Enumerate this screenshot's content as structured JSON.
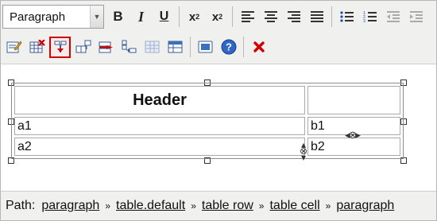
{
  "toolbar": {
    "format_select": {
      "value": "Paragraph"
    },
    "row1": [
      {
        "name": "bold-button",
        "text": "B"
      },
      {
        "name": "italic-button",
        "text": "I"
      },
      {
        "name": "underline-button",
        "text": "U"
      },
      {
        "name": "subscript-button",
        "text": "x"
      },
      {
        "name": "superscript-button",
        "text": "x"
      }
    ],
    "subscript_mark": "2",
    "superscript_mark": "2",
    "row2_icons": [
      "edit-icon",
      "delete-table-icon",
      "split-cell-icon",
      "insert-row-icon",
      "delete-row-icon",
      "insert-column-icon",
      "delete-column-icon",
      "table-grid-icon",
      "frame-icon",
      "help-icon",
      "close-icon"
    ]
  },
  "table": {
    "header": "Header",
    "rows": [
      [
        "a1",
        "b1"
      ],
      [
        "a2",
        "b2"
      ]
    ]
  },
  "statusbar": {
    "label": "Path:",
    "crumbs": [
      "paragraph",
      "table.default",
      "table row",
      "table cell",
      "paragraph"
    ],
    "separator": "»"
  }
}
